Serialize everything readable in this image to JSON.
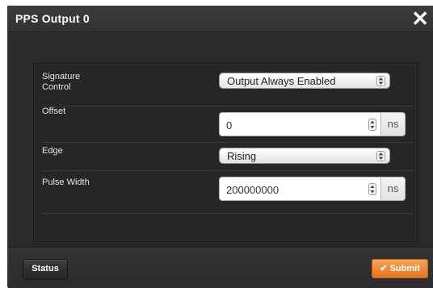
{
  "dialog": {
    "title": "PPS Output 0",
    "close_glyph": "✕"
  },
  "form": {
    "signature_control": {
      "label": "Signature\nControl",
      "label_line1": "Signature",
      "label_line2": "Control",
      "selected": "Output Always Enabled"
    },
    "offset": {
      "label": "Offset",
      "value": "0",
      "unit": "ns"
    },
    "edge": {
      "label": "Edge",
      "selected": "Rising"
    },
    "pulse_width": {
      "label": "Pulse Width",
      "value": "200000000",
      "unit": "ns"
    }
  },
  "footer": {
    "status_label": "Status",
    "submit_label": "Submit",
    "submit_icon": "check-icon"
  },
  "colors": {
    "accent": "#f28c30",
    "dialog_bg": "#2f2f2f",
    "panel_bg": "#262626"
  }
}
